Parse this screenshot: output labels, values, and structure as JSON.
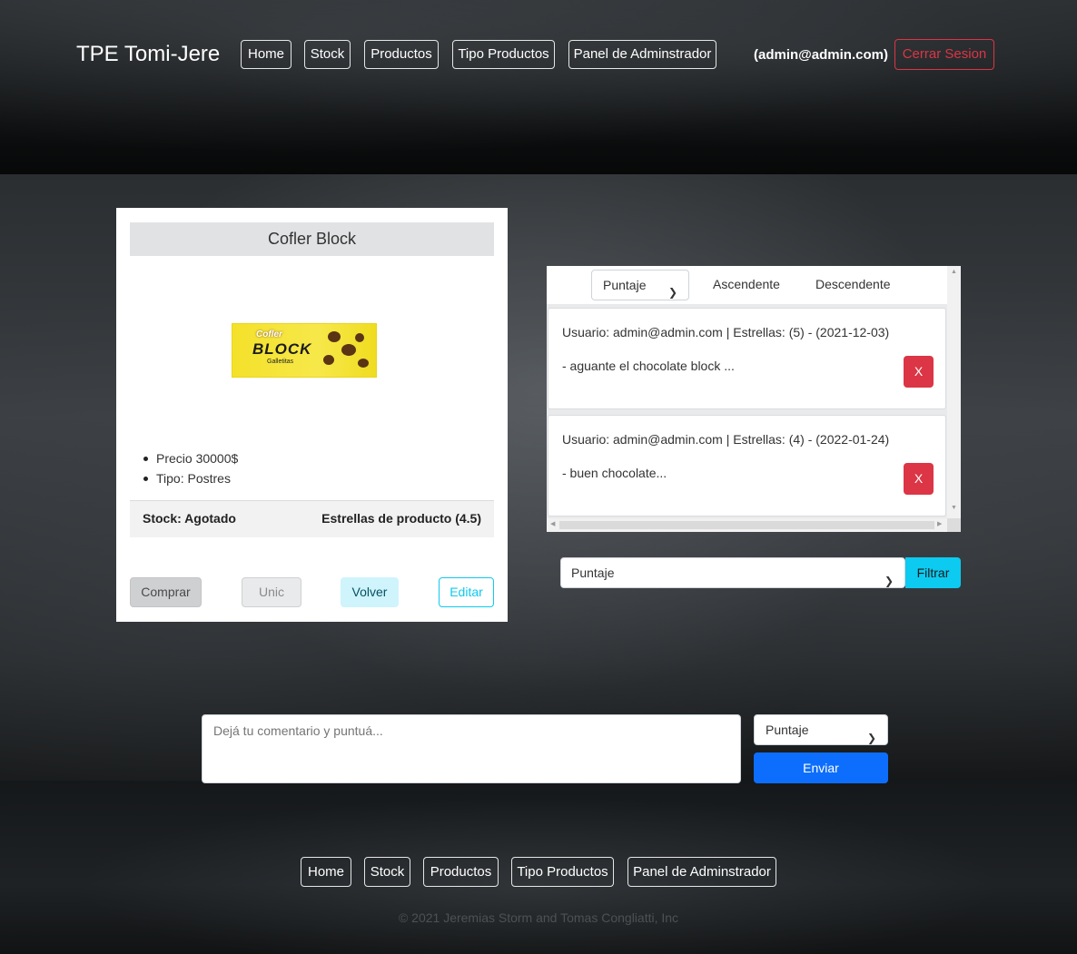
{
  "header": {
    "brand": "TPE Tomi-Jere",
    "nav": [
      "Home",
      "Stock",
      "Productos",
      "Tipo Productos",
      "Panel de Adminstrador"
    ],
    "user": "(admin@admin.com)",
    "logout": "Cerrar Sesion"
  },
  "product": {
    "name": "Cofler Block",
    "image": {
      "brand": "Cofler",
      "name": "BLOCK",
      "sub": "Galletitas"
    },
    "specs": [
      "Precio 30000$",
      "Tipo: Postres"
    ],
    "stock": "Stock: Agotado",
    "stars": "Estrellas de producto (4.5)",
    "buttons": {
      "buy": "Comprar",
      "unic": "Unic",
      "back": "Volver",
      "edit": "Editar"
    }
  },
  "comments": {
    "sort_select": "Puntaje",
    "sort_options": [
      "Ascendente",
      "Descendente"
    ],
    "items": [
      {
        "meta": "Usuario: admin@admin.com | Estrellas: (5) - (2021-12-03)",
        "text": "- aguante el chocolate block ...",
        "delete": "X"
      },
      {
        "meta": "Usuario: admin@admin.com | Estrellas: (4) - (2022-01-24)",
        "text": "- buen chocolate...",
        "delete": "X"
      }
    ],
    "filter_select": "Puntaje",
    "filter_button": "Filtrar"
  },
  "new_comment": {
    "placeholder": "Dejá tu comentario y puntuá...",
    "rating": "Puntaje",
    "submit": "Enviar"
  },
  "footer": {
    "nav": [
      "Home",
      "Stock",
      "Productos",
      "Tipo Productos",
      "Panel de Adminstrador"
    ],
    "copyright": "© 2021 Jeremias Storm and Tomas Congliatti, Inc"
  },
  "colors": {
    "danger": "#dc3545",
    "primary": "#0d6efd",
    "info": "#0dcaf0"
  }
}
